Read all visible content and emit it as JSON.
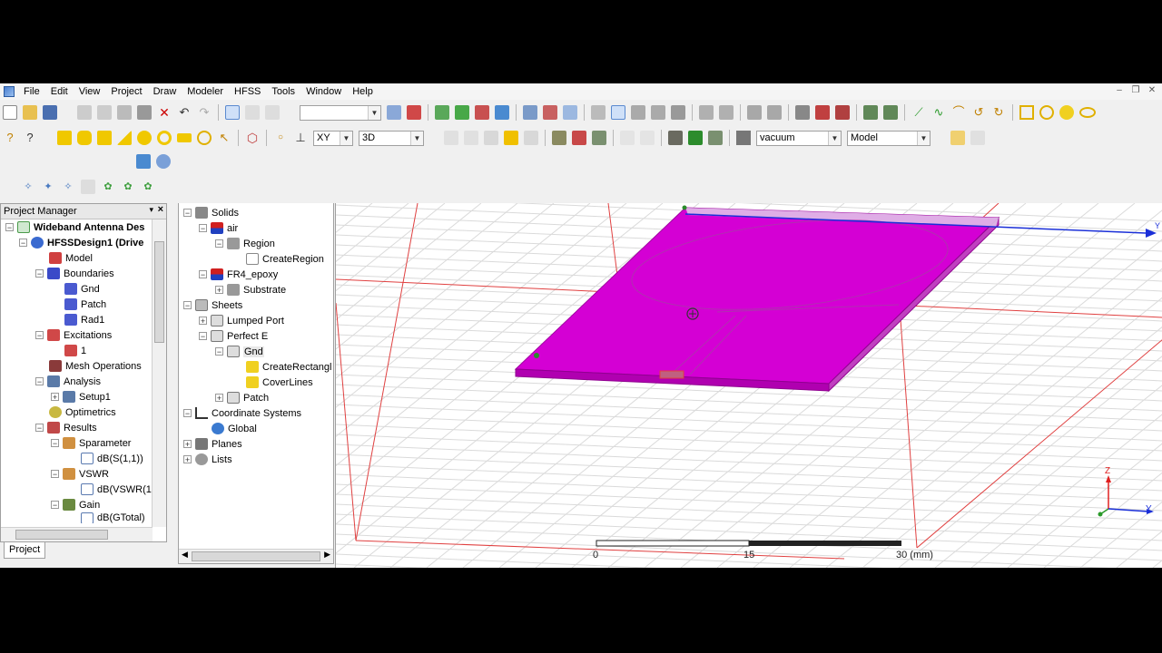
{
  "menu": [
    "File",
    "Edit",
    "View",
    "Project",
    "Draw",
    "Modeler",
    "HFSS",
    "Tools",
    "Window",
    "Help"
  ],
  "toolbar": {
    "plane_select": "XY",
    "view_mode": "3D",
    "material_select": "vacuum",
    "model_select": "Model",
    "empty_select": ""
  },
  "project_manager": {
    "title": "Project Manager",
    "tab_label": "Project",
    "items": [
      {
        "label": "Wideband Antenna Des",
        "bold": true
      },
      {
        "label": "HFSSDesign1 (Drive",
        "bold": true
      },
      {
        "label": "Model"
      },
      {
        "label": "Boundaries"
      },
      {
        "label": "Gnd"
      },
      {
        "label": "Patch"
      },
      {
        "label": "Rad1"
      },
      {
        "label": "Excitations"
      },
      {
        "label": "1"
      },
      {
        "label": "Mesh Operations"
      },
      {
        "label": "Analysis"
      },
      {
        "label": "Setup1"
      },
      {
        "label": "Optimetrics"
      },
      {
        "label": "Results"
      },
      {
        "label": "Sparameter"
      },
      {
        "label": "dB(S(1,1))"
      },
      {
        "label": "VSWR"
      },
      {
        "label": "dB(VSWR(1"
      },
      {
        "label": "Gain"
      },
      {
        "label": "dB(GTotal)"
      }
    ]
  },
  "model_tree": {
    "items": [
      {
        "label": "Solids"
      },
      {
        "label": "air"
      },
      {
        "label": "Region"
      },
      {
        "label": "CreateRegion"
      },
      {
        "label": "FR4_epoxy"
      },
      {
        "label": "Substrate"
      },
      {
        "label": "Sheets"
      },
      {
        "label": "Lumped Port"
      },
      {
        "label": "Perfect E"
      },
      {
        "label": "Gnd"
      },
      {
        "label": "CreateRectangl"
      },
      {
        "label": "CoverLines"
      },
      {
        "label": "Patch"
      },
      {
        "label": "Coordinate Systems"
      },
      {
        "label": "Global"
      },
      {
        "label": "Planes"
      },
      {
        "label": "Lists"
      }
    ]
  },
  "viewport": {
    "scale_labels": [
      "0",
      "15",
      "30 (mm)"
    ],
    "axis_labels": {
      "z": "Z",
      "y": "Y"
    }
  },
  "colors": {
    "model_magenta": "#d400d4",
    "grid": "#d8d8d8",
    "axis_red": "#e03030",
    "axis_blue": "#1a2fd8"
  }
}
